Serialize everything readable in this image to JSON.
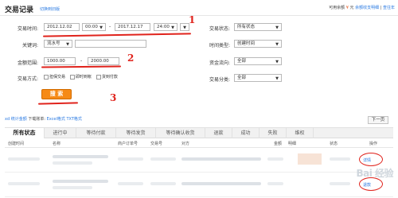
{
  "header": {
    "title": "交易记录",
    "title_link": "切换到旧版",
    "right_prefix": "可用余额",
    "right_amount": "¥",
    "right_unit": "元",
    "right_link_1": "余额收支明细",
    "right_link_2": "查往年"
  },
  "filters": {
    "trade_time_label": "交易时间:",
    "date_from": "2012.12.02",
    "time_from": "00:00",
    "date_to": "2017.12.17",
    "time_to": "24:00",
    "date_dash": "-",
    "keyword_label": "关键词:",
    "keyword_select": "流水号",
    "keyword_value": "",
    "amount_label": "金额范围:",
    "amount_min": "1000.00",
    "amount_max": "2000.00",
    "amount_dash": "-",
    "trade_mode_label": "交易方式:",
    "trade_modes": [
      "担保交易",
      "即时到帐",
      "货到付款"
    ],
    "trade_status_label": "交易状态:",
    "trade_status_value": "所有状态",
    "time_type_label": "时间类型:",
    "time_type_value": "创建时间",
    "fund_flow_label": "资金流向:",
    "fund_flow_value": "全部",
    "trade_category_label": "交易分类:",
    "trade_category_value": "全部",
    "search_button": "搜 索"
  },
  "annotations": {
    "mark_1": "1",
    "mark_2": "2",
    "mark_3": "3"
  },
  "toolbar": {
    "download_prefix": "xd 统计金额",
    "download_label": "下载账单:",
    "excel_link": "Excel格式",
    "txt_link": "TXT格式",
    "next_page": "下一页"
  },
  "tabs": [
    {
      "label": "所有状态",
      "active": true
    },
    {
      "label": "进行中",
      "active": false
    },
    {
      "label": "等待付款",
      "active": false
    },
    {
      "label": "等待发货",
      "active": false
    },
    {
      "label": "等待确认收货",
      "active": false
    },
    {
      "label": "退款",
      "active": false
    },
    {
      "label": "成功",
      "active": false
    },
    {
      "label": "失败",
      "active": false
    },
    {
      "label": "维权",
      "active": false
    }
  ],
  "table": {
    "headers": [
      "创建时间",
      "名称",
      "商户订单号",
      "交易号",
      "对方",
      "金额",
      "明细",
      "状态",
      "操作"
    ],
    "rows": [
      {
        "op": "详情"
      },
      {
        "op": "退款"
      }
    ]
  },
  "watermark": "Bai 经验",
  "colors": {
    "accent": "#f68a16",
    "link": "#2a7ae2",
    "annotation_red": "#e0231c"
  }
}
